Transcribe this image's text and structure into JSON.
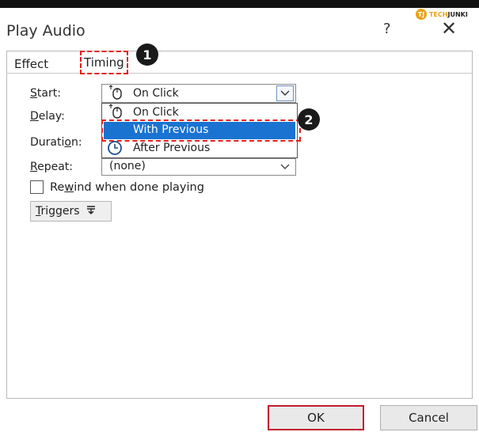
{
  "window": {
    "title": "Play Audio",
    "help": "?",
    "close": "✕"
  },
  "watermark": {
    "badge": "TJ",
    "tech": "TECH",
    "junki": "JUNKI"
  },
  "tabs": {
    "effect": "Effect",
    "timing": "Timing"
  },
  "callouts": {
    "one": "1",
    "two": "2"
  },
  "labels": {
    "start_prefix": "S",
    "start_rest": "tart:",
    "delay_prefix": "D",
    "delay_rest": "elay:",
    "duration_head": "Durati",
    "duration_u": "o",
    "duration_tail": "n:",
    "repeat_prefix": "R",
    "repeat_rest": "epeat:"
  },
  "start_field": {
    "value": "On Click",
    "icon": "mouse-icon"
  },
  "start_options": [
    {
      "label": "On Click",
      "icon": "mouse-icon"
    },
    {
      "label": "With Previous",
      "icon": "",
      "selected": true
    },
    {
      "label": "After Previous",
      "icon": "clock-icon"
    }
  ],
  "repeat_field": {
    "value": "(none)"
  },
  "rewind": {
    "head": "Re",
    "u": "w",
    "tail": "ind when done playing",
    "checked": false
  },
  "triggers": {
    "u": "T",
    "rest": "riggers",
    "icon": "triggers-icon"
  },
  "buttons": {
    "ok": "OK",
    "cancel": "Cancel"
  },
  "colors": {
    "highlight": "#1a73d1",
    "callout_red": "#e02020",
    "ok_border": "#c01e2e"
  }
}
